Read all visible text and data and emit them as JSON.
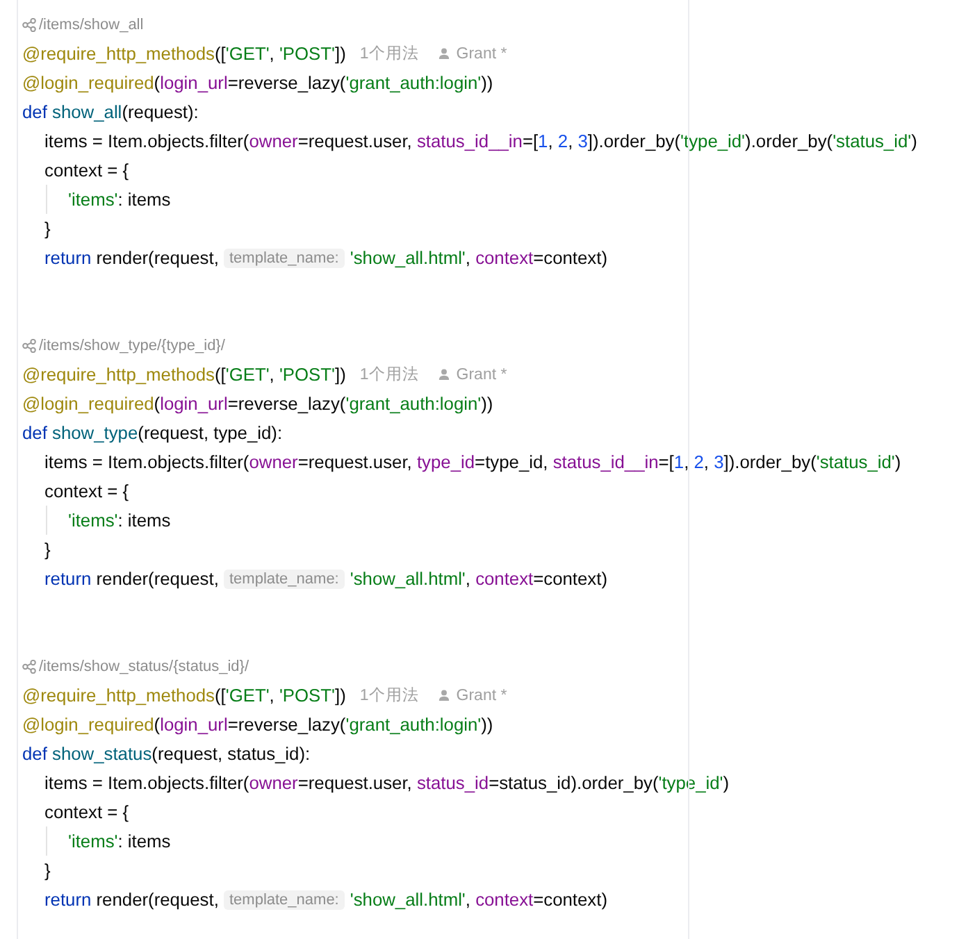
{
  "blocks": [
    {
      "route": "/items/show_all",
      "lines": [
        {
          "tokens": [
            {
              "kind": "deco",
              "text": "@require_http_methods"
            },
            {
              "kind": "plain",
              "text": "(["
            },
            {
              "kind": "str",
              "text": "'GET'",
              "after": ", "
            },
            {
              "kind": "str",
              "text": "'POST'"
            },
            {
              "kind": "plain",
              "text": "])"
            },
            {
              "kind": "usages",
              "text": "1个用法"
            },
            {
              "kind": "author",
              "text": "Grant *"
            }
          ]
        },
        {
          "tokens": [
            {
              "kind": "deco",
              "text": "@login_required"
            },
            {
              "kind": "plain",
              "text": "("
            },
            {
              "kind": "param",
              "text": "login_url"
            },
            {
              "kind": "plain",
              "text": "=reverse_lazy("
            },
            {
              "kind": "str",
              "text": "'grant_auth:login'"
            },
            {
              "kind": "plain",
              "text": "))"
            }
          ]
        },
        {
          "tokens": [
            {
              "kind": "kw",
              "text": "def "
            },
            {
              "kind": "fn",
              "text": "show_all"
            },
            {
              "kind": "plain",
              "text": "(request):"
            }
          ],
          "children": [
            {
              "tokens": [
                {
                  "kind": "plain",
                  "text": "items = Item.objects.filter("
                },
                {
                  "kind": "param",
                  "text": "owner"
                },
                {
                  "kind": "plain",
                  "text": "=request.user, "
                },
                {
                  "kind": "param",
                  "text": "status_id__in"
                },
                {
                  "kind": "plain",
                  "text": "=["
                },
                {
                  "kind": "num",
                  "text": "1",
                  "after": ", "
                },
                {
                  "kind": "num",
                  "text": "2",
                  "after": ", "
                },
                {
                  "kind": "num",
                  "text": "3"
                },
                {
                  "kind": "plain",
                  "text": "]).order_by("
                },
                {
                  "kind": "str",
                  "text": "'type_id'"
                },
                {
                  "kind": "plain",
                  "text": ").order_by("
                },
                {
                  "kind": "str",
                  "text": "'status_id'"
                },
                {
                  "kind": "plain",
                  "text": ")"
                }
              ]
            },
            {
              "tokens": [
                {
                  "kind": "plain",
                  "text": "context = {"
                }
              ],
              "children": [
                {
                  "tokens": [
                    {
                      "kind": "str",
                      "text": "'items'"
                    },
                    {
                      "kind": "plain",
                      "text": ": items"
                    }
                  ]
                }
              ]
            },
            {
              "tokens": [
                {
                  "kind": "plain",
                  "text": "}"
                }
              ]
            },
            {
              "tokens": [
                {
                  "kind": "kw",
                  "text": "return"
                },
                {
                  "kind": "plain",
                  "text": " render(request, "
                },
                {
                  "kind": "hint",
                  "text": "template_name:"
                },
                {
                  "kind": "str",
                  "text": "'show_all.html'",
                  "after": ", "
                },
                {
                  "kind": "param",
                  "text": "context"
                },
                {
                  "kind": "plain",
                  "text": "=context)"
                }
              ]
            }
          ]
        }
      ]
    },
    {
      "route": "/items/show_type/{type_id}/",
      "lines": [
        {
          "tokens": [
            {
              "kind": "deco",
              "text": "@require_http_methods"
            },
            {
              "kind": "plain",
              "text": "(["
            },
            {
              "kind": "str",
              "text": "'GET'",
              "after": ", "
            },
            {
              "kind": "str",
              "text": "'POST'"
            },
            {
              "kind": "plain",
              "text": "])"
            },
            {
              "kind": "usages",
              "text": "1个用法"
            },
            {
              "kind": "author",
              "text": "Grant *"
            }
          ]
        },
        {
          "tokens": [
            {
              "kind": "deco",
              "text": "@login_required"
            },
            {
              "kind": "plain",
              "text": "("
            },
            {
              "kind": "param",
              "text": "login_url"
            },
            {
              "kind": "plain",
              "text": "=reverse_lazy("
            },
            {
              "kind": "str",
              "text": "'grant_auth:login'"
            },
            {
              "kind": "plain",
              "text": "))"
            }
          ]
        },
        {
          "tokens": [
            {
              "kind": "kw",
              "text": "def "
            },
            {
              "kind": "fn",
              "text": "show_type"
            },
            {
              "kind": "plain",
              "text": "(request, type_id):"
            }
          ],
          "children": [
            {
              "tokens": [
                {
                  "kind": "plain",
                  "text": "items = Item.objects.filter("
                },
                {
                  "kind": "param",
                  "text": "owner"
                },
                {
                  "kind": "plain",
                  "text": "=request.user, "
                },
                {
                  "kind": "param",
                  "text": "type_id"
                },
                {
                  "kind": "plain",
                  "text": "=type_id, "
                },
                {
                  "kind": "param",
                  "text": "status_id__in"
                },
                {
                  "kind": "plain",
                  "text": "=["
                },
                {
                  "kind": "num",
                  "text": "1",
                  "after": ", "
                },
                {
                  "kind": "num",
                  "text": "2",
                  "after": ", "
                },
                {
                  "kind": "num",
                  "text": "3"
                },
                {
                  "kind": "plain",
                  "text": "]).order_by("
                },
                {
                  "kind": "str",
                  "text": "'status_id'"
                },
                {
                  "kind": "plain",
                  "text": ")"
                }
              ]
            },
            {
              "tokens": [
                {
                  "kind": "plain",
                  "text": "context = {"
                }
              ],
              "children": [
                {
                  "tokens": [
                    {
                      "kind": "str",
                      "text": "'items'"
                    },
                    {
                      "kind": "plain",
                      "text": ": items"
                    }
                  ]
                }
              ]
            },
            {
              "tokens": [
                {
                  "kind": "plain",
                  "text": "}"
                }
              ]
            },
            {
              "tokens": [
                {
                  "kind": "kw",
                  "text": "return"
                },
                {
                  "kind": "plain",
                  "text": " render(request, "
                },
                {
                  "kind": "hint",
                  "text": "template_name:"
                },
                {
                  "kind": "str",
                  "text": "'show_all.html'",
                  "after": ", "
                },
                {
                  "kind": "param",
                  "text": "context"
                },
                {
                  "kind": "plain",
                  "text": "=context)"
                }
              ]
            }
          ]
        }
      ]
    },
    {
      "route": "/items/show_status/{status_id}/",
      "lines": [
        {
          "tokens": [
            {
              "kind": "deco",
              "text": "@require_http_methods"
            },
            {
              "kind": "plain",
              "text": "(["
            },
            {
              "kind": "str",
              "text": "'GET'",
              "after": ", "
            },
            {
              "kind": "str",
              "text": "'POST'"
            },
            {
              "kind": "plain",
              "text": "])"
            },
            {
              "kind": "usages",
              "text": "1个用法"
            },
            {
              "kind": "author",
              "text": "Grant *"
            }
          ]
        },
        {
          "tokens": [
            {
              "kind": "deco",
              "text": "@login_required"
            },
            {
              "kind": "plain",
              "text": "("
            },
            {
              "kind": "param",
              "text": "login_url"
            },
            {
              "kind": "plain",
              "text": "=reverse_lazy("
            },
            {
              "kind": "str",
              "text": "'grant_auth:login'"
            },
            {
              "kind": "plain",
              "text": "))"
            }
          ]
        },
        {
          "tokens": [
            {
              "kind": "kw",
              "text": "def "
            },
            {
              "kind": "fn",
              "text": "show_status"
            },
            {
              "kind": "plain",
              "text": "(request, status_id):"
            }
          ],
          "children": [
            {
              "tokens": [
                {
                  "kind": "plain",
                  "text": "items = Item.objects.filter("
                },
                {
                  "kind": "param",
                  "text": "owner"
                },
                {
                  "kind": "plain",
                  "text": "=request.user, "
                },
                {
                  "kind": "param",
                  "text": "status_id"
                },
                {
                  "kind": "plain",
                  "text": "=status_id).order_by("
                },
                {
                  "kind": "str",
                  "text": "'type_id'"
                },
                {
                  "kind": "plain",
                  "text": ")"
                }
              ]
            },
            {
              "tokens": [
                {
                  "kind": "plain",
                  "text": "context = {"
                }
              ],
              "children": [
                {
                  "tokens": [
                    {
                      "kind": "str",
                      "text": "'items'"
                    },
                    {
                      "kind": "plain",
                      "text": ": items"
                    }
                  ]
                }
              ]
            },
            {
              "tokens": [
                {
                  "kind": "plain",
                  "text": "}"
                }
              ]
            },
            {
              "tokens": [
                {
                  "kind": "kw",
                  "text": "return"
                },
                {
                  "kind": "plain",
                  "text": " render(request, "
                },
                {
                  "kind": "hint",
                  "text": "template_name:"
                },
                {
                  "kind": "str",
                  "text": "'show_all.html'",
                  "after": ", "
                },
                {
                  "kind": "param",
                  "text": "context"
                },
                {
                  "kind": "plain",
                  "text": "=context)"
                }
              ]
            }
          ]
        }
      ]
    }
  ]
}
